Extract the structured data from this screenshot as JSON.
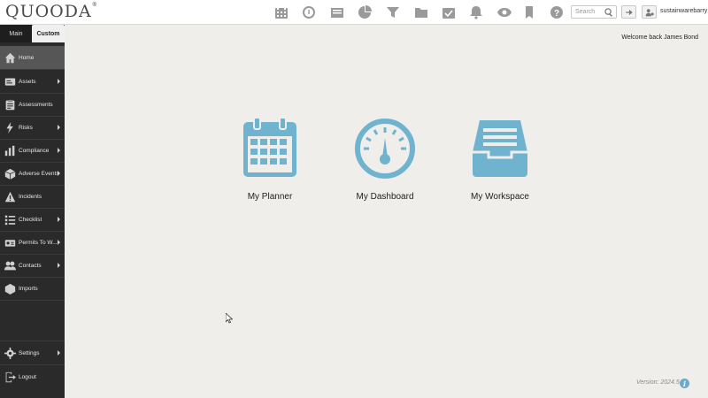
{
  "app": {
    "logo_text": "QUOODA",
    "logo_reg": "®"
  },
  "header": {
    "icons": [
      "calendar-icon",
      "gauge-icon",
      "inbox-icon",
      "pie-chart-icon",
      "filter-icon",
      "folder-icon",
      "checklist-icon",
      "bell-icon",
      "eye-icon",
      "bookmark-icon",
      "help-icon"
    ],
    "search_placeholder": "Search",
    "username": "sustainwarebarry"
  },
  "sidebar": {
    "tabs": [
      {
        "label": "Main"
      },
      {
        "label": "Custom"
      }
    ],
    "items": [
      {
        "label": "Home",
        "icon": "home-icon",
        "has_submenu": false,
        "active": true
      },
      {
        "label": "Assets",
        "icon": "assets-icon",
        "has_submenu": true
      },
      {
        "label": "Assessments",
        "icon": "clipboard-icon",
        "has_submenu": false
      },
      {
        "label": "Risks",
        "icon": "lightning-icon",
        "has_submenu": true
      },
      {
        "label": "Compliance",
        "icon": "bar-chart-icon",
        "has_submenu": true
      },
      {
        "label": "Adverse Events",
        "icon": "cube-icon",
        "has_submenu": true
      },
      {
        "label": "Incidents",
        "icon": "warning-icon",
        "has_submenu": false
      },
      {
        "label": "Checklist",
        "icon": "list-icon",
        "has_submenu": true
      },
      {
        "label": "Permits To W...",
        "icon": "permit-icon",
        "has_submenu": true
      },
      {
        "label": "Contacts",
        "icon": "contacts-icon",
        "has_submenu": true
      },
      {
        "label": "Imports",
        "icon": "import-icon",
        "has_submenu": false
      }
    ],
    "bottom_items": [
      {
        "label": "Settings",
        "icon": "gear-icon",
        "has_submenu": true
      },
      {
        "label": "Logout",
        "icon": "logout-icon",
        "has_submenu": false
      }
    ]
  },
  "main": {
    "welcome": "Welcome back James Bond",
    "tiles": [
      {
        "label": "My Planner",
        "icon": "planner-calendar-icon"
      },
      {
        "label": "My Dashboard",
        "icon": "dashboard-gauge-icon"
      },
      {
        "label": "My Workspace",
        "icon": "workspace-inbox-icon"
      }
    ],
    "version": "Version: 2024.5",
    "accent_color": "#6fb3cf"
  }
}
